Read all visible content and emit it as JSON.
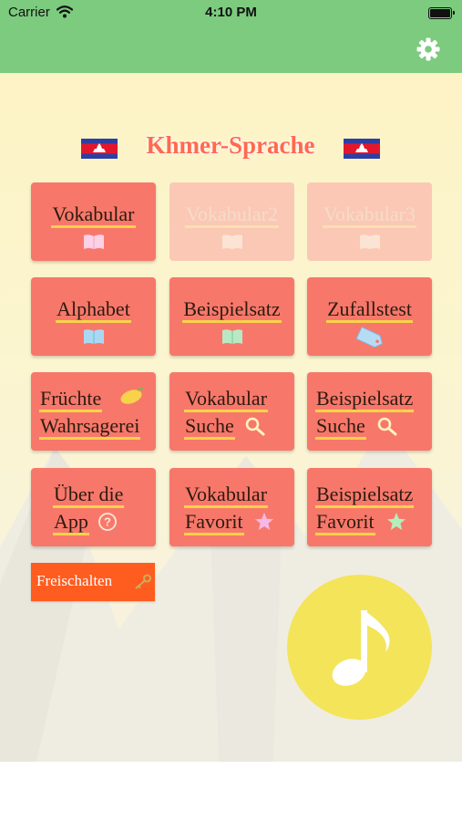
{
  "status": {
    "carrier": "Carrier",
    "time": "4:10 PM"
  },
  "app": {
    "title": "Khmer-Sprache"
  },
  "tiles": [
    {
      "lines": [
        "Vokabular"
      ],
      "icon": "open-book-icon",
      "enabled": true
    },
    {
      "lines": [
        "Vokabular2"
      ],
      "icon": "open-book-icon",
      "enabled": false
    },
    {
      "lines": [
        "Vokabular3"
      ],
      "icon": "open-book-icon",
      "enabled": false
    },
    {
      "lines": [
        "Alphabet"
      ],
      "icon": "blue-book-icon",
      "enabled": true
    },
    {
      "lines": [
        "Beispielsatz"
      ],
      "icon": "green-book-icon",
      "enabled": true
    },
    {
      "lines": [
        "Zufallstest"
      ],
      "icon": "tag-icon",
      "enabled": true
    },
    {
      "lines": [
        "Früchte",
        "Wahrsagerei"
      ],
      "icon": "mango-icon",
      "enabled": true
    },
    {
      "lines": [
        "Vokabular",
        "Suche"
      ],
      "icon": "magnifier-icon",
      "enabled": true
    },
    {
      "lines": [
        "Beispielsatz",
        "Suche"
      ],
      "icon": "magnifier-icon",
      "enabled": true
    },
    {
      "lines": [
        "Über die",
        "App"
      ],
      "icon": "question-icon",
      "enabled": true
    },
    {
      "lines": [
        "Vokabular",
        "Favorit"
      ],
      "icon": "pink-star-icon",
      "enabled": true
    },
    {
      "lines": [
        "Beispielsatz",
        "Favorit"
      ],
      "icon": "green-star-icon",
      "enabled": true
    }
  ],
  "unlock_button": {
    "label": "Freischalten",
    "icon": "key-icon"
  },
  "music_button": {
    "icon": "music-note-icon"
  },
  "colors": {
    "header": "#7ccb7e",
    "tile": "#f7786a",
    "unlock": "#ff5c20",
    "music": "#f3e45a",
    "title": "#ff6a4d"
  }
}
